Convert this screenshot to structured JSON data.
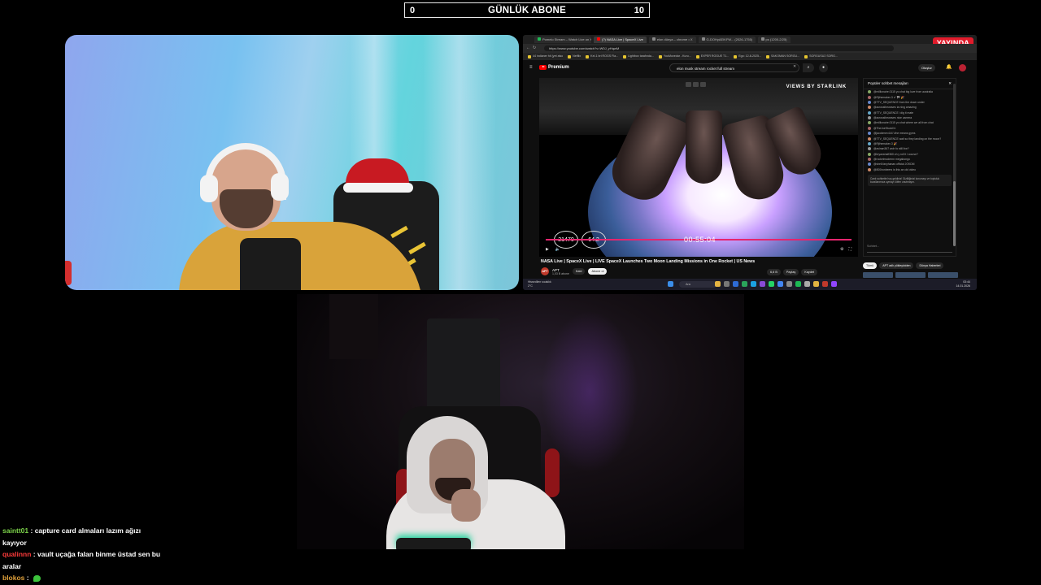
{
  "goal": {
    "title": "GÜNLÜK ABONE",
    "current": "0",
    "target": "10"
  },
  "browser": {
    "live_badge": "YAYINDA",
    "tabs": [
      {
        "label": "Pomelo Stream – Watch Live on X",
        "color": "#1db954",
        "active": false
      },
      {
        "label": "(?) NASA Live | SpaceX Live",
        "color": "#ff0000",
        "active": true
      },
      {
        "label": "elon dünya – chrome • X",
        "color": "#888888",
        "active": false
      },
      {
        "label": "G-DOHyAEIKFW... (2026-1755)",
        "color": "#888888",
        "active": false
      },
      {
        "label": "ps (1200-2/25)",
        "color": "#888888",
        "active": false
      }
    ],
    "url": "https://www.youtube.com/watch?v=W0J_yHqwM",
    "bookmarks": [
      "44 indianer hit (yet also",
      "Netflix",
      "Kel-1 bri ROGS Fla...",
      "Lightbox tarafında...",
      "YouMovedar - Kuru...",
      "EXPER ROGUE T1...",
      "Ego: 12-8-2025...",
      "SAKOMAN SORGU...",
      "SORGUSU2 SORG..."
    ],
    "yt_brand": "Premium",
    "search_query": "elon musk stream rocket full stream",
    "create_label": "Oluştur",
    "player": {
      "watermark": "VIEWS BY STARLINK",
      "speed": "21470",
      "altitude": "64.2",
      "timer": "00:55:04",
      "brand_small": "APT"
    },
    "video_title": "NASA Live | SpaceX Live | LIVE SpaceX Launches Two Moon Landing Missions in One Rocket | US News",
    "channel": {
      "icon": "APT",
      "name": "APT",
      "subs": "1,03 B abone"
    },
    "buttons": {
      "join": "Katıl",
      "subscribe": "Abone ol",
      "likes": "6,6 B",
      "share": "Paylaş",
      "save": "Kaydet"
    },
    "chat": {
      "header": "Popüler sohbet mesajları",
      "messages": [
        "@millionaire.0115  yo chat big love from australia",
        "@Rjthemaker-3  ✔ 🏁 🎉",
        "@TTV_SEQUENCE  from the down under",
        "@acrossthewaves  ta ning amazing",
        "@TTV_SEQUENCE  i dig it mate",
        "@acrossthewaves  nice camera",
        "@millionaire.0115  yo chat where we all from chat",
        "@TheJoeStudd  hi",
        "@jacobmev444  Vine means gyms",
        "@TTV_SEQUENCE  wait so they landing on the moon?",
        "@Rjthemaker-3  🎉",
        "@avinan367  woh fo still live?",
        "@bryanshalf360  oh y roll it i course?",
        "@rocketmodernn  megabongo",
        "@shell.fanyhanan.official  JOKDM",
        "@800ironbeers  is this an old video"
      ],
      "note": "Canlı sohbette hoş geldiniz! Gizliliğinizi korumayı ve topluluk kurallarımıza uymayı lütfen unutmayın.",
      "input_placeholder": "Sohbet...",
      "tabs": [
        "Tümü",
        "APT adlı yükleyiciden",
        "Dünya Haberleri"
      ]
    },
    "taskbar": {
      "weather": [
        "Hissedilen sıcaklık",
        "2°C"
      ],
      "search": "Ara",
      "clock": [
        "03:44",
        "14.01.2026"
      ]
    }
  },
  "twitch_chat": [
    {
      "user": "saintt01",
      "user_color": "#7cd34a",
      "text": "capture card almaları lazım ağızı kayıyor",
      "emote": false
    },
    {
      "user": "qualinnn",
      "user_color": "#ff3b3b",
      "text": "vault uçağa falan binme üstad sen bu aralar",
      "emote": false
    },
    {
      "user": "blokos",
      "user_color": "#e2a23b",
      "text": "",
      "emote": true
    }
  ]
}
